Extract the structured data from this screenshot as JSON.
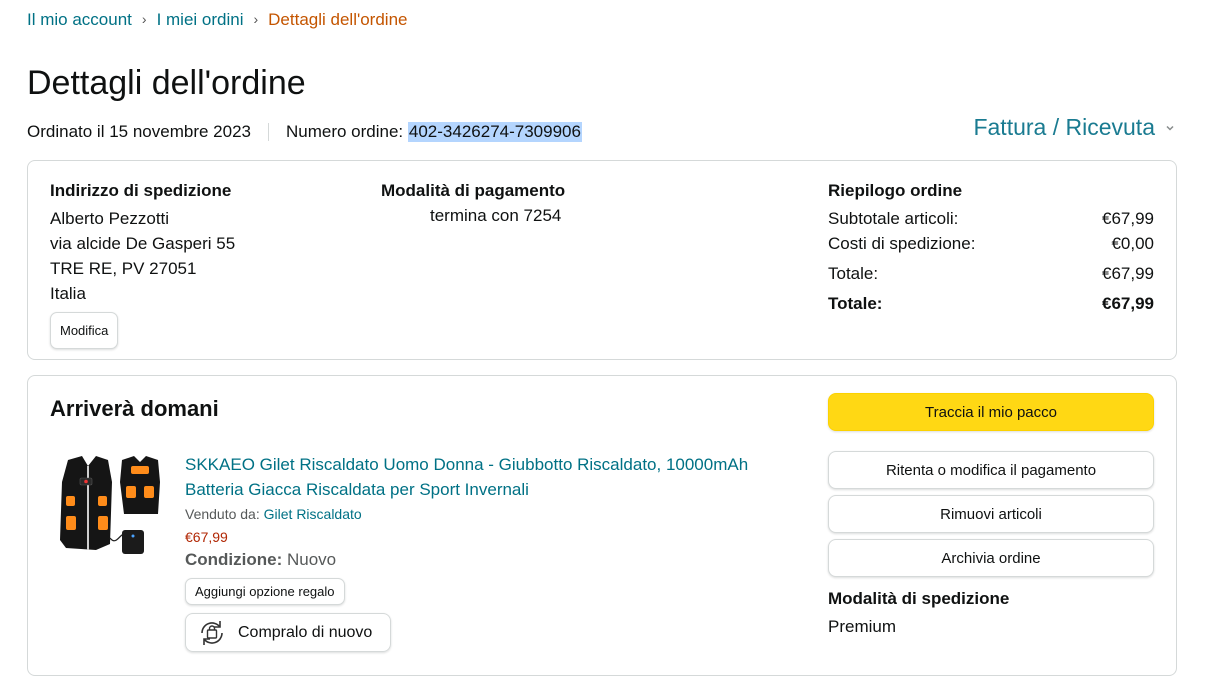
{
  "breadcrumb": {
    "items": [
      "Il mio account",
      "I miei ordini"
    ],
    "current": "Dettagli dell'ordine",
    "separator": "›"
  },
  "page_title": "Dettagli dell'ordine",
  "order_meta": {
    "date_text": "Ordinato il 15 novembre 2023",
    "number_label": "Numero ordine:",
    "number_value": "402-3426274-7309906"
  },
  "invoice_link": "Fattura / Ricevuta",
  "shipping_address": {
    "heading": "Indirizzo di spedizione",
    "lines": [
      "Alberto Pezzotti",
      "via alcide De Gasperi 55",
      "TRE RE, PV 27051",
      "Italia"
    ],
    "edit_label": "Modifica"
  },
  "payment": {
    "heading": "Modalità di pagamento",
    "line": "termina con 7254"
  },
  "summary": {
    "heading": "Riepilogo ordine",
    "rows": [
      {
        "label": "Subtotale articoli:",
        "value": "€67,99"
      },
      {
        "label": "Costi di spedizione:",
        "value": "€0,00"
      },
      {
        "label": "Totale:",
        "value": "€67,99"
      },
      {
        "label": "Totale:",
        "value": "€67,99"
      }
    ]
  },
  "shipment": {
    "arrival": "Arriverà domani",
    "product": {
      "title": "SKKAEO Gilet Riscaldato Uomo Donna - Giubbotto Riscaldato, 10000mAh Batteria Giacca Riscaldata per Sport Invernali",
      "sold_by_label": "Venduto da:",
      "seller": "Gilet Riscaldato",
      "price": "€67,99",
      "condition_label": "Condizione:",
      "condition_value": "Nuovo",
      "gift_label": "Aggiungi opzione regalo",
      "buy_again_label": "Compralo di nuovo"
    },
    "actions": {
      "track": "Traccia il mio pacco",
      "retry_payment": "Ritenta o modifica il pagamento",
      "remove_items": "Rimuovi articoli",
      "archive": "Archivia ordine"
    },
    "shipping_mode_heading": "Modalità di spedizione",
    "shipping_mode_value": "Premium"
  },
  "colors": {
    "link": "#007185",
    "breadcrumb_current": "#c45500",
    "price": "#b12704",
    "primary_button": "#ffd814",
    "border": "#d5d9d9"
  }
}
